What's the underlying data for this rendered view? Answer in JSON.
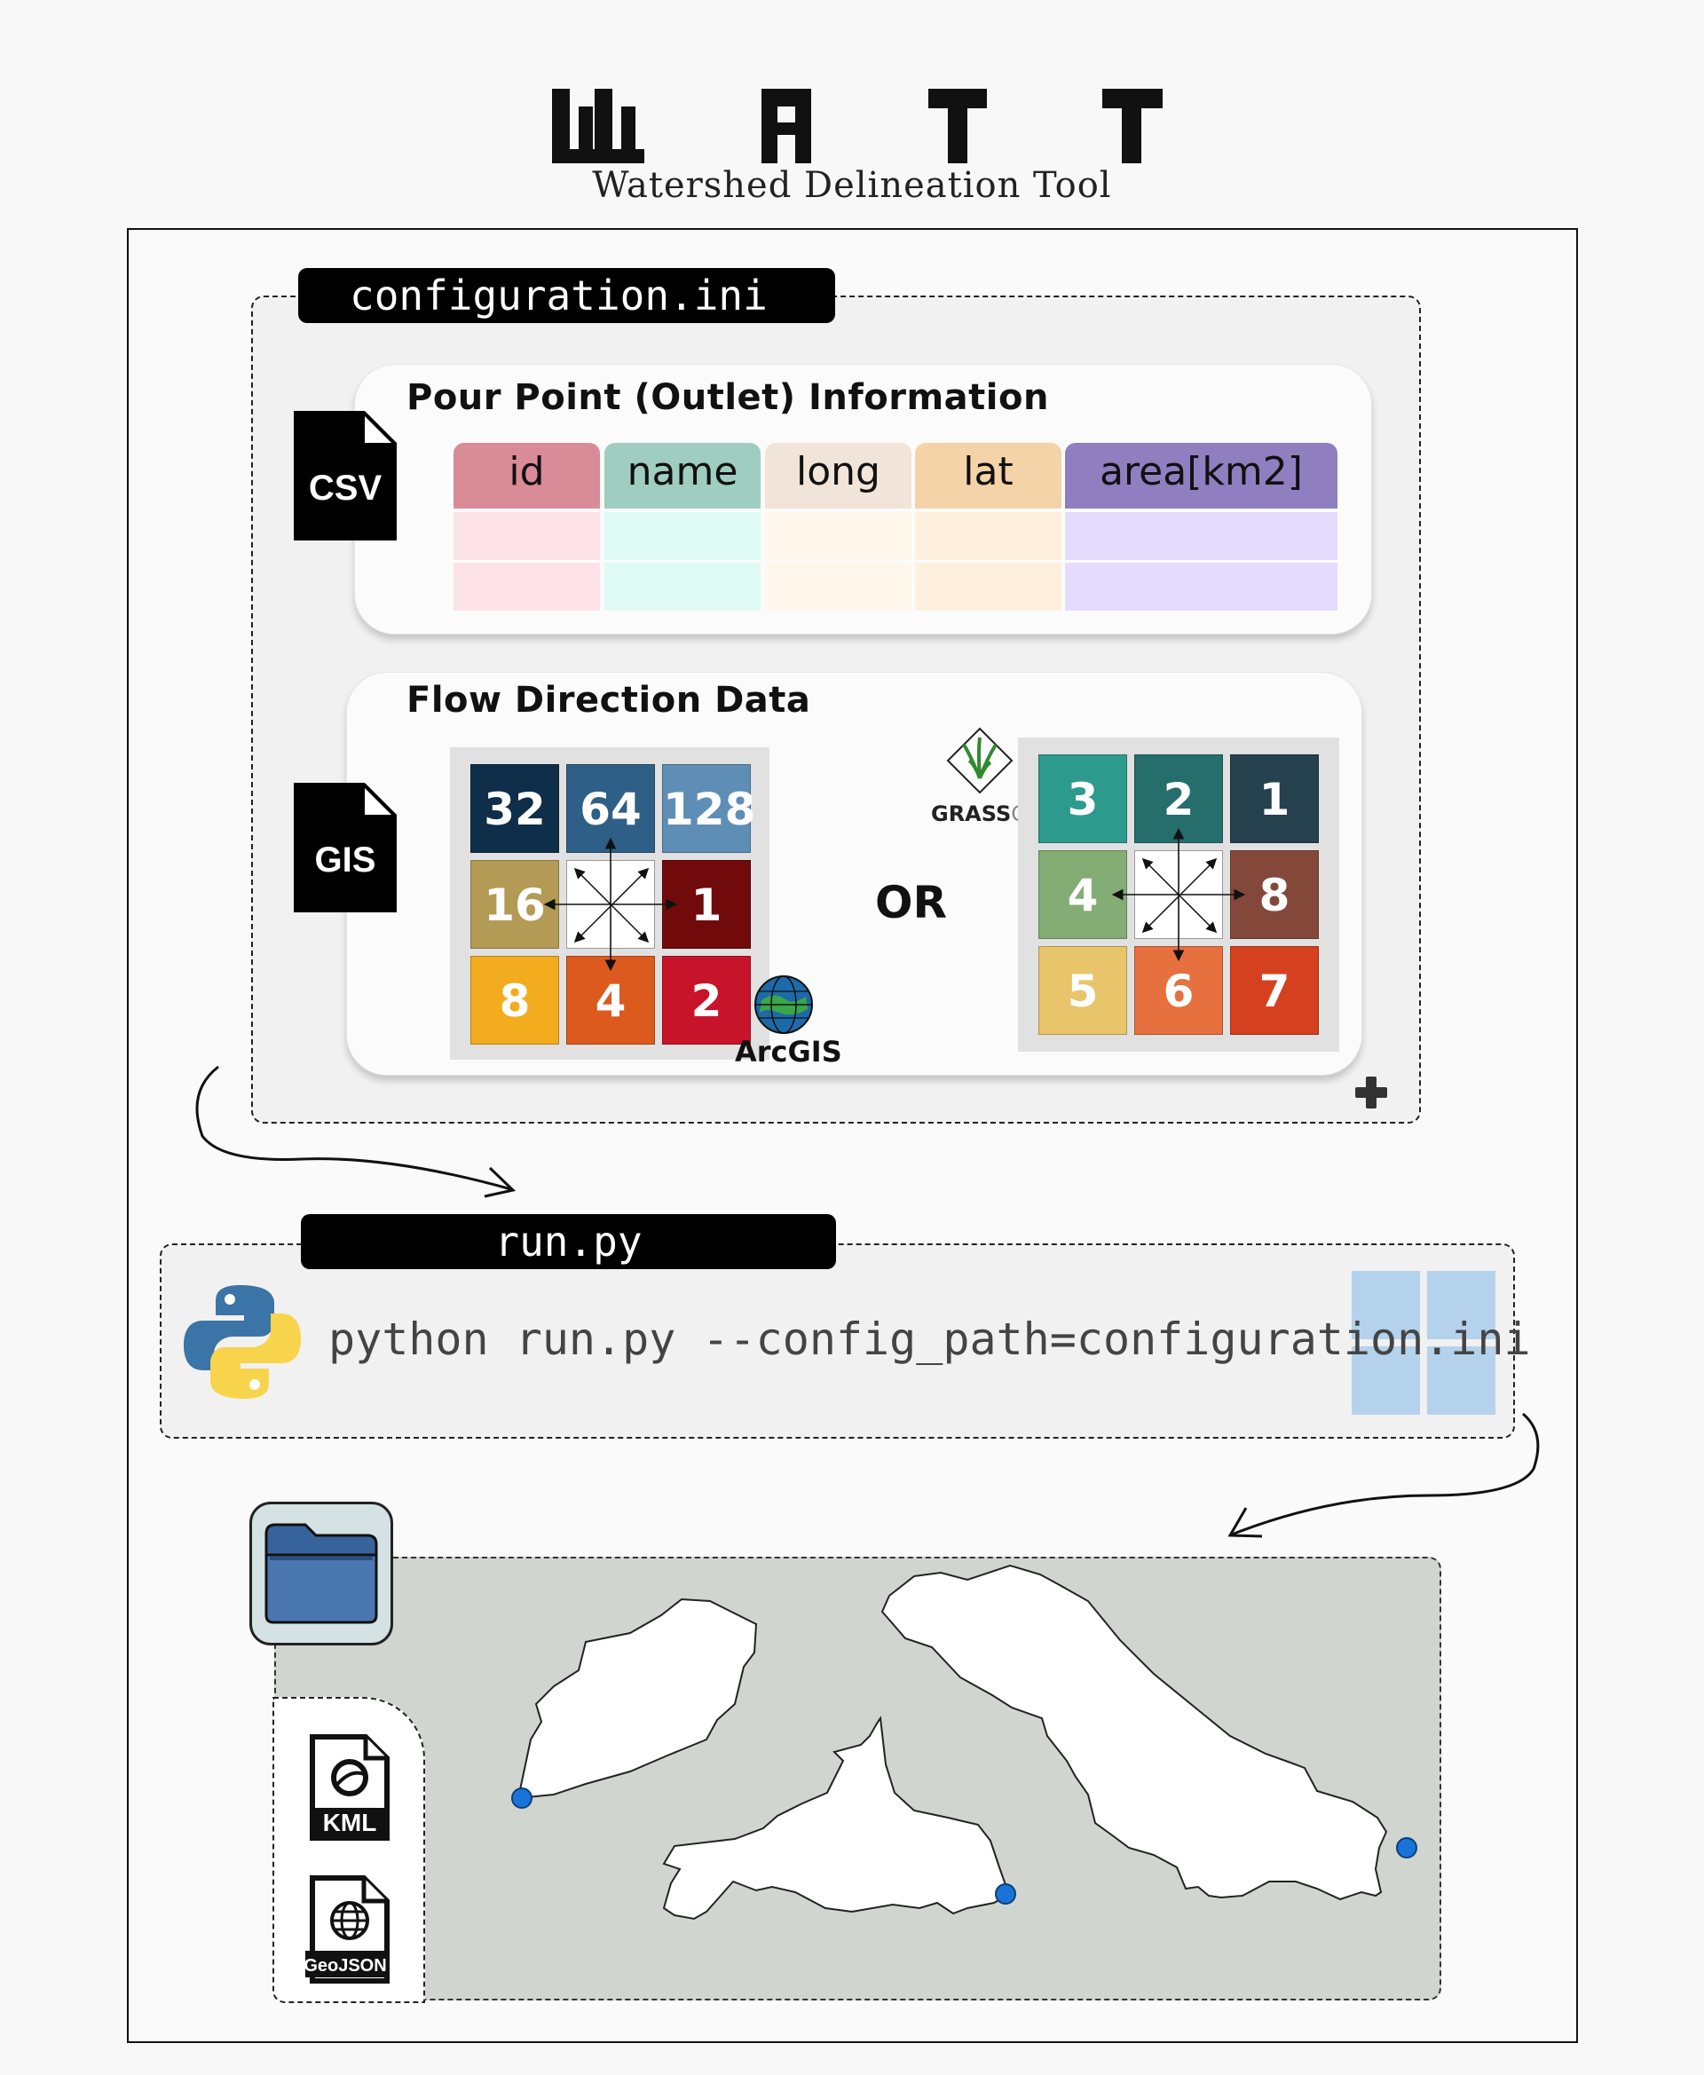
{
  "header": {
    "logo_text": "WATT",
    "subtitle": "Watershed Delineation Tool"
  },
  "config": {
    "filename": "configuration.ini",
    "pour_point": {
      "title": "Pour Point (Outlet) Information",
      "file_type": "CSV",
      "columns": [
        {
          "label": "id",
          "head_color": "#d98b98",
          "cell_color": "#fde3e8"
        },
        {
          "label": "name",
          "head_color": "#9fcdbf",
          "cell_color": "#e0fbf4"
        },
        {
          "label": "long",
          "head_color": "#f1e4d8",
          "cell_color": "#fff6ec"
        },
        {
          "label": "lat",
          "head_color": "#f4d3a8",
          "cell_color": "#fff0de"
        },
        {
          "label": "area[km2]",
          "head_color": "#8f7fc0",
          "cell_color": "#e5dcfd"
        }
      ]
    },
    "flow_direction": {
      "title": "Flow Direction Data",
      "file_type": "GIS",
      "separator": "OR",
      "arcgis": {
        "label": "ArcGIS",
        "cells": [
          {
            "value": "32",
            "color": "#0e2e4a"
          },
          {
            "value": "64",
            "color": "#2e5f86"
          },
          {
            "value": "128",
            "color": "#5e8eb6"
          },
          {
            "value": "16",
            "color": "#b49b55"
          },
          {
            "value": "",
            "color": "#ffffff"
          },
          {
            "value": "1",
            "color": "#710a0a"
          },
          {
            "value": "8",
            "color": "#f3ac1e"
          },
          {
            "value": "4",
            "color": "#dd5a1e"
          },
          {
            "value": "2",
            "color": "#c8142a"
          }
        ]
      },
      "grass": {
        "label_main": "GRASS",
        "label_sub": "GIS",
        "cells": [
          {
            "value": "3",
            "color": "#2c9a8c"
          },
          {
            "value": "2",
            "color": "#256e6c"
          },
          {
            "value": "1",
            "color": "#25414e"
          },
          {
            "value": "4",
            "color": "#83ad74"
          },
          {
            "value": "",
            "color": "#ffffff"
          },
          {
            "value": "8",
            "color": "#834839"
          },
          {
            "value": "5",
            "color": "#e8c56b"
          },
          {
            "value": "6",
            "color": "#e7703f"
          },
          {
            "value": "7",
            "color": "#d5411f"
          }
        ]
      }
    }
  },
  "run": {
    "filename": "run.py",
    "command": "python run.py --config_path=configuration.ini"
  },
  "output": {
    "formats": [
      "KML",
      "GeoJSON"
    ]
  },
  "colors": {
    "python_blue": "#3b74a6",
    "python_yellow": "#f8d44c",
    "outlet_point": "#1a73d9",
    "map_background": "#d0d6cf",
    "folder_blue": "#4a77b0"
  }
}
